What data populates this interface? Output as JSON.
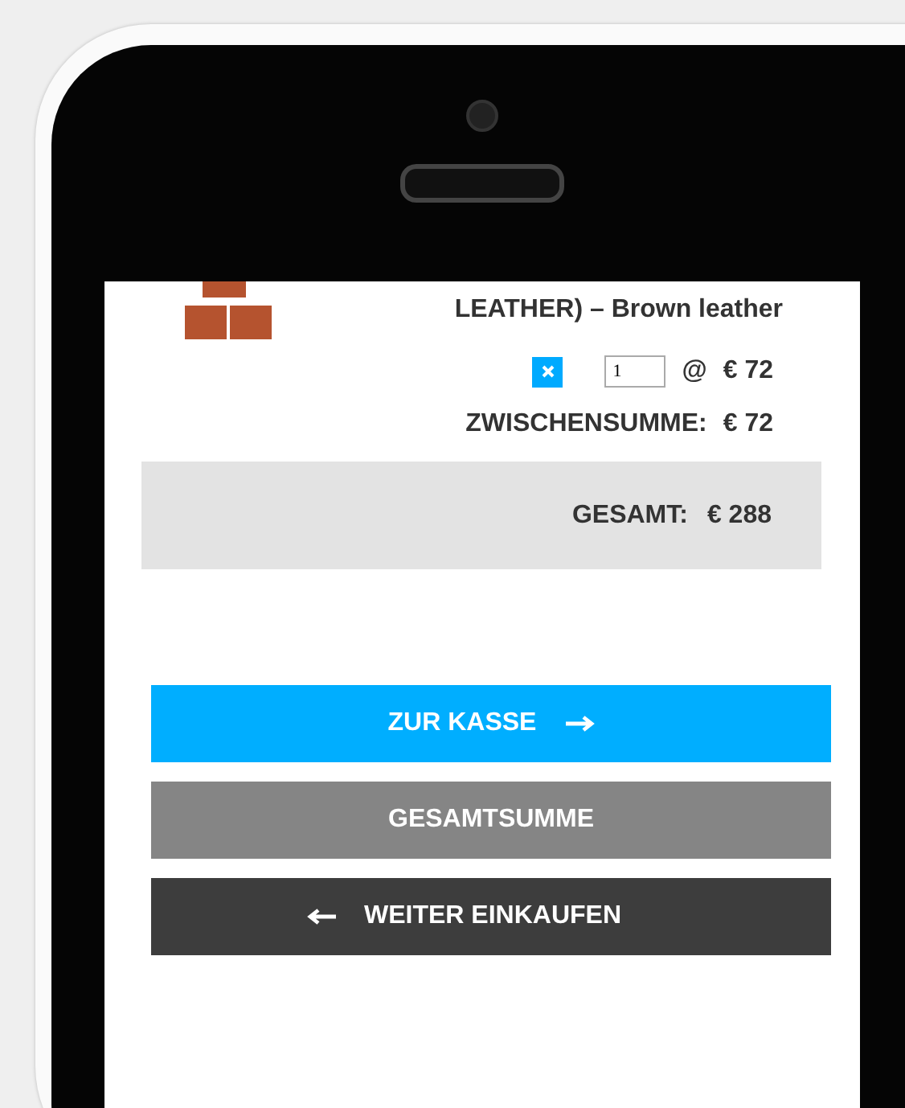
{
  "cart_item": {
    "name": "LEATHER) – Brown leather",
    "quantity": "1",
    "at": "@",
    "price": "€ 72"
  },
  "subtotal": {
    "label": "ZWISCHENSUMME:",
    "value": "€ 72"
  },
  "total": {
    "label": "GESAMT:",
    "value": "€ 288"
  },
  "buttons": [
    {
      "kind": "checkout",
      "label": "ZUR KASSE"
    },
    {
      "kind": "update",
      "label": "GESAMTSUMME"
    },
    {
      "kind": "continue",
      "label": "WEITER EINKAUFEN"
    }
  ]
}
